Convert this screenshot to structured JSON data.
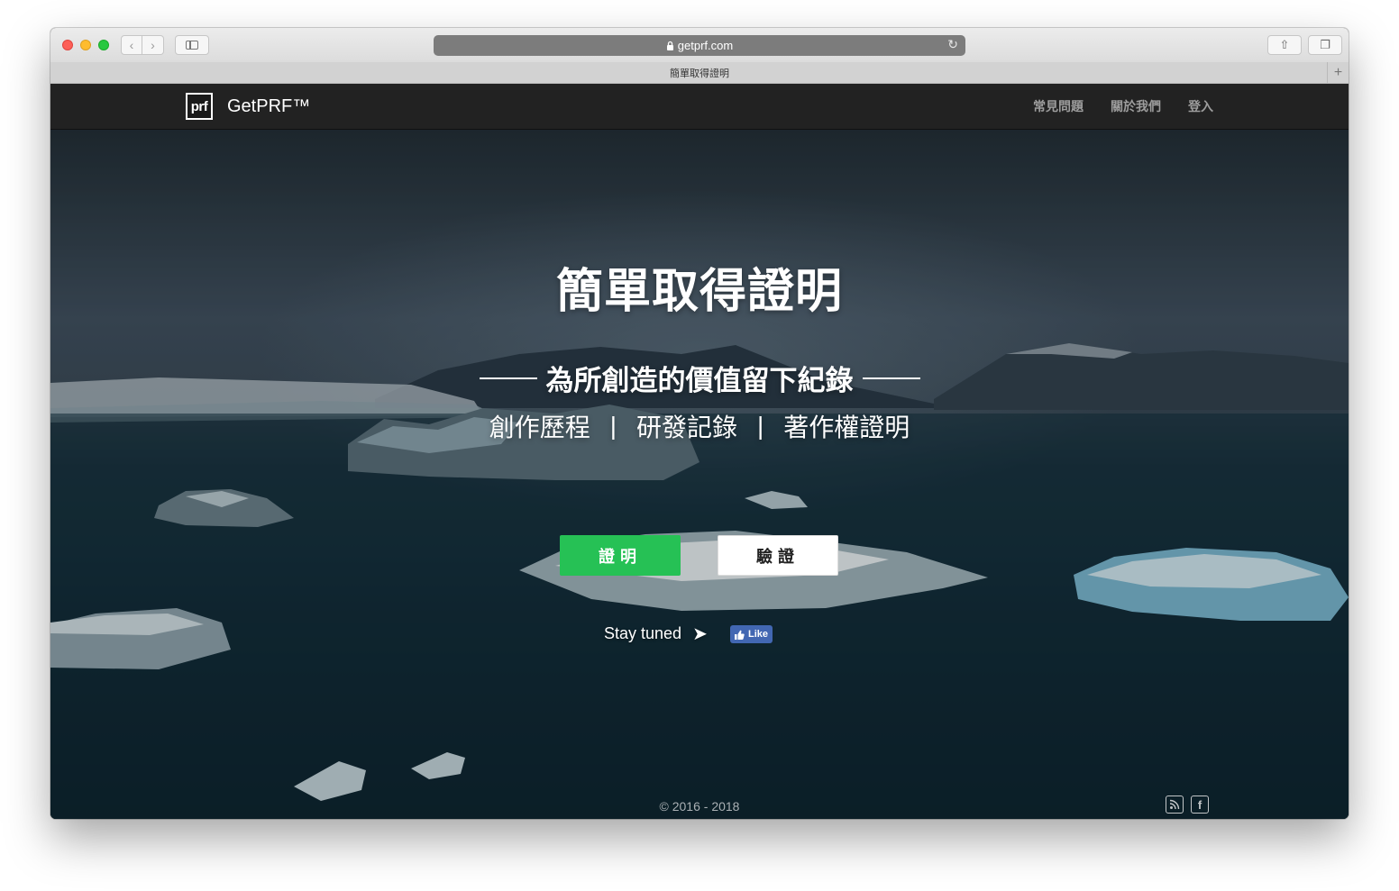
{
  "browser": {
    "url": "getprf.com",
    "tab_title": "簡單取得證明",
    "back_glyph": "‹",
    "forward_glyph": "›",
    "reload_glyph": "↻",
    "share_glyph": "⇧",
    "tabs_glyph": "❐",
    "new_tab_glyph": "+"
  },
  "navbar": {
    "logo_text": "prf",
    "brand": "GetPRF™",
    "links": [
      {
        "label": "常見問題"
      },
      {
        "label": "關於我們"
      },
      {
        "label": "登入"
      }
    ]
  },
  "hero": {
    "title": "簡單取得證明",
    "subtitle": "為所創造的價值留下紀錄",
    "tags": [
      "創作歷程",
      "研發記錄",
      "著作權證明"
    ],
    "separator": "|"
  },
  "actions": {
    "prove_label": "證明",
    "verify_label": "驗證",
    "stay_tuned": "Stay tuned",
    "arrow_glyph": "➤",
    "like_label": "Like"
  },
  "footer": {
    "copyright": "© 2016 - 2018",
    "rss_glyph": "⌁",
    "fb_glyph": "f"
  },
  "colors": {
    "navbar_bg": "#222222",
    "prove_button": "#26c155",
    "verify_button": "#ffffff",
    "facebook": "#4267b2"
  },
  "icons": [
    "lock-icon",
    "reload-icon",
    "share-icon",
    "tabs-icon",
    "rss-icon",
    "facebook-icon",
    "thumbs-up-icon",
    "arrow-right-icon"
  ]
}
